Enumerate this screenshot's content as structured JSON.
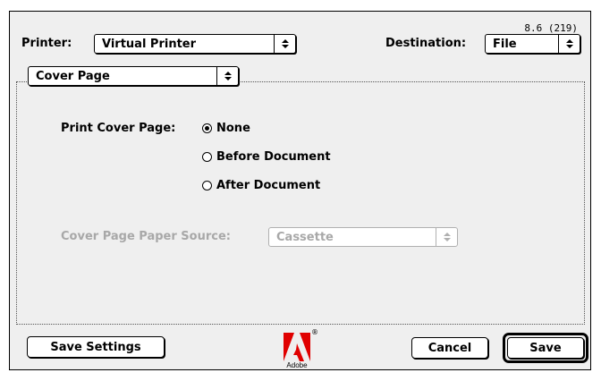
{
  "version": "8.6 (219)",
  "printer": {
    "label": "Printer:",
    "value": "Virtual Printer"
  },
  "destination": {
    "label": "Destination:",
    "value": "File"
  },
  "panel": {
    "value": "Cover Page"
  },
  "cover_page": {
    "label": "Print Cover Page:",
    "options": [
      {
        "label": "None",
        "checked": true
      },
      {
        "label": "Before Document",
        "checked": false
      },
      {
        "label": "After Document",
        "checked": false
      }
    ],
    "paper_source_label": "Cover Page Paper Source:",
    "paper_source_value": "Cassette"
  },
  "buttons": {
    "save_settings": "Save Settings",
    "cancel": "Cancel",
    "save": "Save"
  },
  "logo": {
    "text": "Adobe",
    "registered": "®",
    "icon": "adobe-logo-icon",
    "color": "#e00000"
  }
}
